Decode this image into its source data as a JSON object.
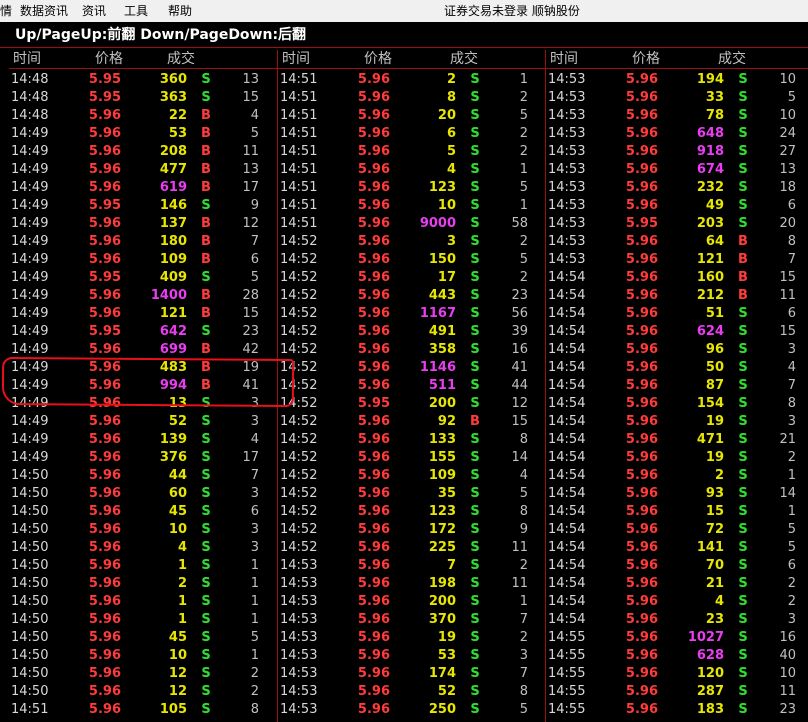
{
  "menubar": {
    "items": [
      "情",
      "数据资讯",
      "资讯",
      "工具",
      "帮助"
    ],
    "status": "证券交易未登录 顺钠股份"
  },
  "hint": "Up/PageUp:前翻 Down/PageDown:后翻",
  "headers": {
    "time": "时间",
    "price": "价格",
    "volume": "成交"
  },
  "colors": {
    "up": "#ff3b3b",
    "down": "#e6e600",
    "big": "#e83ef0",
    "buy": "#ff3b3b",
    "sell": "#2ee02e"
  },
  "panels": [
    {
      "rows": [
        [
          "14:48",
          "5.95",
          "360",
          "S",
          "13"
        ],
        [
          "14:48",
          "5.95",
          "363",
          "S",
          "15"
        ],
        [
          "14:48",
          "5.96",
          "22",
          "B",
          "4"
        ],
        [
          "14:49",
          "5.96",
          "53",
          "B",
          "5"
        ],
        [
          "14:49",
          "5.96",
          "208",
          "B",
          "11"
        ],
        [
          "14:49",
          "5.96",
          "477",
          "B",
          "13"
        ],
        [
          "14:49",
          "5.96",
          "619",
          "B",
          "17"
        ],
        [
          "14:49",
          "5.95",
          "146",
          "S",
          "9"
        ],
        [
          "14:49",
          "5.96",
          "137",
          "B",
          "12"
        ],
        [
          "14:49",
          "5.96",
          "180",
          "B",
          "7"
        ],
        [
          "14:49",
          "5.96",
          "109",
          "B",
          "6"
        ],
        [
          "14:49",
          "5.95",
          "409",
          "S",
          "5"
        ],
        [
          "14:49",
          "5.96",
          "1400",
          "B",
          "28"
        ],
        [
          "14:49",
          "5.96",
          "121",
          "B",
          "15"
        ],
        [
          "14:49",
          "5.95",
          "642",
          "S",
          "23"
        ],
        [
          "14:49",
          "5.96",
          "699",
          "B",
          "42"
        ],
        [
          "14:49",
          "5.96",
          "483",
          "B",
          "19"
        ],
        [
          "14:49",
          "5.96",
          "994",
          "B",
          "41"
        ],
        [
          "14:49",
          "5.96",
          "13",
          "S",
          "3"
        ],
        [
          "14:49",
          "5.96",
          "52",
          "S",
          "3"
        ],
        [
          "14:49",
          "5.96",
          "139",
          "S",
          "4"
        ],
        [
          "14:49",
          "5.96",
          "376",
          "S",
          "17"
        ],
        [
          "14:50",
          "5.96",
          "44",
          "S",
          "7"
        ],
        [
          "14:50",
          "5.96",
          "60",
          "S",
          "3"
        ],
        [
          "14:50",
          "5.96",
          "45",
          "S",
          "6"
        ],
        [
          "14:50",
          "5.96",
          "10",
          "S",
          "3"
        ],
        [
          "14:50",
          "5.96",
          "4",
          "S",
          "3"
        ],
        [
          "14:50",
          "5.96",
          "1",
          "S",
          "1"
        ],
        [
          "14:50",
          "5.96",
          "2",
          "S",
          "1"
        ],
        [
          "14:50",
          "5.96",
          "1",
          "S",
          "1"
        ],
        [
          "14:50",
          "5.96",
          "1",
          "S",
          "1"
        ],
        [
          "14:50",
          "5.96",
          "45",
          "S",
          "5"
        ],
        [
          "14:50",
          "5.96",
          "10",
          "S",
          "1"
        ],
        [
          "14:50",
          "5.96",
          "12",
          "S",
          "2"
        ],
        [
          "14:50",
          "5.96",
          "12",
          "S",
          "2"
        ],
        [
          "14:51",
          "5.96",
          "105",
          "S",
          "8"
        ]
      ]
    },
    {
      "rows": [
        [
          "14:51",
          "5.96",
          "2",
          "S",
          "1"
        ],
        [
          "14:51",
          "5.96",
          "8",
          "S",
          "2"
        ],
        [
          "14:51",
          "5.96",
          "20",
          "S",
          "5"
        ],
        [
          "14:51",
          "5.96",
          "6",
          "S",
          "2"
        ],
        [
          "14:51",
          "5.96",
          "5",
          "S",
          "2"
        ],
        [
          "14:51",
          "5.96",
          "4",
          "S",
          "1"
        ],
        [
          "14:51",
          "5.96",
          "123",
          "S",
          "5"
        ],
        [
          "14:51",
          "5.96",
          "10",
          "S",
          "1"
        ],
        [
          "14:51",
          "5.96",
          "9000",
          "S",
          "58"
        ],
        [
          "14:52",
          "5.96",
          "3",
          "S",
          "2"
        ],
        [
          "14:52",
          "5.96",
          "150",
          "S",
          "5"
        ],
        [
          "14:52",
          "5.96",
          "17",
          "S",
          "2"
        ],
        [
          "14:52",
          "5.96",
          "443",
          "S",
          "23"
        ],
        [
          "14:52",
          "5.96",
          "1167",
          "S",
          "56"
        ],
        [
          "14:52",
          "5.96",
          "491",
          "S",
          "39"
        ],
        [
          "14:52",
          "5.96",
          "358",
          "S",
          "16"
        ],
        [
          "14:52",
          "5.96",
          "1146",
          "S",
          "41"
        ],
        [
          "14:52",
          "5.96",
          "511",
          "S",
          "44"
        ],
        [
          "14:52",
          "5.95",
          "200",
          "S",
          "12"
        ],
        [
          "14:52",
          "5.96",
          "92",
          "B",
          "15"
        ],
        [
          "14:52",
          "5.96",
          "133",
          "S",
          "8"
        ],
        [
          "14:52",
          "5.96",
          "155",
          "S",
          "14"
        ],
        [
          "14:52",
          "5.96",
          "109",
          "S",
          "4"
        ],
        [
          "14:52",
          "5.96",
          "35",
          "S",
          "5"
        ],
        [
          "14:52",
          "5.96",
          "123",
          "S",
          "8"
        ],
        [
          "14:52",
          "5.96",
          "172",
          "S",
          "9"
        ],
        [
          "14:52",
          "5.96",
          "225",
          "S",
          "11"
        ],
        [
          "14:53",
          "5.96",
          "7",
          "S",
          "2"
        ],
        [
          "14:53",
          "5.96",
          "198",
          "S",
          "11"
        ],
        [
          "14:53",
          "5.96",
          "200",
          "S",
          "1"
        ],
        [
          "14:53",
          "5.96",
          "370",
          "S",
          "7"
        ],
        [
          "14:53",
          "5.96",
          "19",
          "S",
          "2"
        ],
        [
          "14:53",
          "5.96",
          "53",
          "S",
          "3"
        ],
        [
          "14:53",
          "5.96",
          "174",
          "S",
          "7"
        ],
        [
          "14:53",
          "5.96",
          "52",
          "S",
          "8"
        ],
        [
          "14:53",
          "5.96",
          "250",
          "S",
          "5"
        ]
      ]
    },
    {
      "rows": [
        [
          "14:53",
          "5.96",
          "194",
          "S",
          "10"
        ],
        [
          "14:53",
          "5.96",
          "33",
          "S",
          "5"
        ],
        [
          "14:53",
          "5.96",
          "78",
          "S",
          "10"
        ],
        [
          "14:53",
          "5.96",
          "648",
          "S",
          "24"
        ],
        [
          "14:53",
          "5.96",
          "918",
          "S",
          "27"
        ],
        [
          "14:53",
          "5.96",
          "674",
          "S",
          "13"
        ],
        [
          "14:53",
          "5.96",
          "232",
          "S",
          "18"
        ],
        [
          "14:53",
          "5.96",
          "49",
          "S",
          "6"
        ],
        [
          "14:53",
          "5.95",
          "203",
          "S",
          "20"
        ],
        [
          "14:53",
          "5.96",
          "64",
          "B",
          "8"
        ],
        [
          "14:53",
          "5.96",
          "121",
          "B",
          "7"
        ],
        [
          "14:54",
          "5.96",
          "160",
          "B",
          "15"
        ],
        [
          "14:54",
          "5.96",
          "212",
          "B",
          "11"
        ],
        [
          "14:54",
          "5.96",
          "51",
          "S",
          "6"
        ],
        [
          "14:54",
          "5.96",
          "624",
          "S",
          "15"
        ],
        [
          "14:54",
          "5.96",
          "96",
          "S",
          "3"
        ],
        [
          "14:54",
          "5.96",
          "50",
          "S",
          "4"
        ],
        [
          "14:54",
          "5.96",
          "87",
          "S",
          "7"
        ],
        [
          "14:54",
          "5.96",
          "154",
          "S",
          "8"
        ],
        [
          "14:54",
          "5.96",
          "19",
          "S",
          "3"
        ],
        [
          "14:54",
          "5.96",
          "471",
          "S",
          "21"
        ],
        [
          "14:54",
          "5.96",
          "19",
          "S",
          "2"
        ],
        [
          "14:54",
          "5.96",
          "2",
          "S",
          "1"
        ],
        [
          "14:54",
          "5.96",
          "93",
          "S",
          "14"
        ],
        [
          "14:54",
          "5.96",
          "15",
          "S",
          "1"
        ],
        [
          "14:54",
          "5.96",
          "72",
          "S",
          "5"
        ],
        [
          "14:54",
          "5.96",
          "141",
          "S",
          "5"
        ],
        [
          "14:54",
          "5.96",
          "70",
          "S",
          "6"
        ],
        [
          "14:54",
          "5.96",
          "21",
          "S",
          "2"
        ],
        [
          "14:54",
          "5.96",
          "4",
          "S",
          "2"
        ],
        [
          "14:54",
          "5.96",
          "23",
          "S",
          "3"
        ],
        [
          "14:55",
          "5.96",
          "1027",
          "S",
          "16"
        ],
        [
          "14:55",
          "5.96",
          "628",
          "S",
          "40"
        ],
        [
          "14:55",
          "5.96",
          "120",
          "S",
          "10"
        ],
        [
          "14:55",
          "5.96",
          "287",
          "S",
          "11"
        ],
        [
          "14:55",
          "5.96",
          "183",
          "S",
          "23"
        ]
      ]
    }
  ]
}
